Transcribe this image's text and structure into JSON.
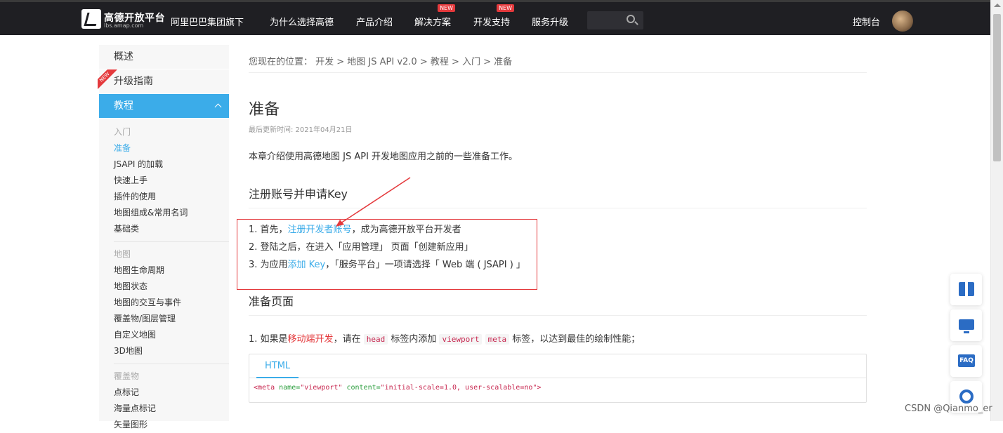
{
  "header": {
    "brand": "高德开放平台",
    "brand_sub": "lbs.amap.com",
    "group": "阿里巴巴集团旗下",
    "nav": [
      {
        "label": "为什么选择高德",
        "badge": ""
      },
      {
        "label": "产品介绍",
        "badge": ""
      },
      {
        "label": "解决方案",
        "badge": "NEW"
      },
      {
        "label": "开发支持",
        "badge": "NEW"
      },
      {
        "label": "服务升级",
        "badge": ""
      }
    ],
    "console": "控制台"
  },
  "sidebar": {
    "heads": [
      {
        "label": "概述"
      },
      {
        "label": "升级指南",
        "ribbon": "NEW"
      },
      {
        "label": "教程"
      }
    ],
    "groups": [
      {
        "cat": "入门",
        "items": [
          "准备",
          "JSAPI 的加载",
          "快速上手",
          "插件的使用",
          "地图组成&常用名词",
          "基础类"
        ]
      },
      {
        "cat": "地图",
        "items": [
          "地图生命周期",
          "地图状态",
          "地图的交互与事件",
          "覆盖物/图层管理",
          "自定义地图",
          "3D地图"
        ]
      },
      {
        "cat": "覆盖物",
        "items": [
          "点标记",
          "海量点标记",
          "矢量图形"
        ]
      }
    ],
    "current": "准备"
  },
  "main": {
    "breadcrumb": "您现在的位置： 开发 > 地图 JS API v2.0 > 教程 > 入门 > 准备",
    "title": "准备",
    "updated": "最后更新时间: 2021年04月21日",
    "intro": "本章介绍使用高德地图 JS API 开发地图应用之前的一些准备工作。",
    "section1": "注册账号并申请Key",
    "steps": {
      "s1_pre": "1. 首先，",
      "s1_link": "注册开发者账号",
      "s1_post": "，成为高德开放平台开发者",
      "s2": "2. 登陆之后，在进入「应用管理」 页面「创建新应用」",
      "s3_pre": "3. 为应用",
      "s3_link": "添加 Key",
      "s3_post": "，「服务平台」一项请选择「 Web 端 ( JSAPI ) 」"
    },
    "section2": "准备页面",
    "note": {
      "pre": "1. 如果是",
      "mobile": "移动端开发",
      "mid1": "，请在 ",
      "code1": "head",
      "mid2": " 标签内添加 ",
      "code2": "viewport",
      "mid3": " ",
      "code3": "meta",
      "post": " 标签，以达到最佳的绘制性能；"
    },
    "code_tab": "HTML",
    "code_line": {
      "open": "<meta",
      "a1": " name=",
      "v1": "\"viewport\"",
      "a2": " content=",
      "v2": "\"initial-scale=1.0, user-scalable=no\"",
      "close": ">"
    }
  },
  "fabs": {
    "faq": "FAQ"
  },
  "watermark": "CSDN @Qianmo_er",
  "colors": {
    "accent": "#3bace9",
    "topbar": "#1f1f23",
    "highlight": "#e4393c"
  }
}
